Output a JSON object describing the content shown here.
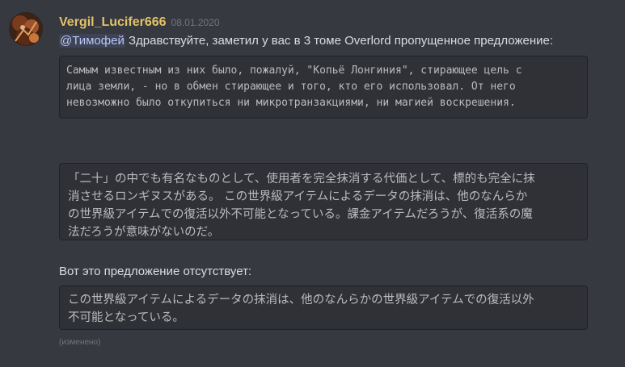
{
  "message": {
    "author": "Vergil_Lucifer666",
    "timestamp": "08.01.2020",
    "mention": "@Тимофей",
    "intro_text": " Здравствуйте, заметил у вас в 3 томе Overlord пропущенное предложение:",
    "code_russian": "Самым известным из них было, пожалуй, \"Копьё Лонгиния\", стирающее цель с\nлица земли, - но в обмен стирающее и того, кто его использовал. От него\nневозможно было откупиться ни микротранзакциями, ни магией воскрешения.",
    "code_japanese": "「二十」の中でも有名なものとして、使用者を完全抹消する代価として、標的も完全に抹\n消させるロンギヌスがある。 この世界級アイテムによるデータの抹消は、他のなんらか\nの世界級アイテムでの復活以外不可能となっている。課金アイテムだろうが、復活系の魔\n法だろうが意味がないのだ。",
    "missing_label": "Вот это предложение отсутствует:",
    "code_missing": "この世界級アイテムによるデータの抹消は、他のなんらかの世界級アイテムでの復活以外\n不可能となっている。",
    "edited_label": "(изменено)"
  },
  "colors": {
    "background": "#36393f",
    "username": "#e3c36a",
    "codeblock_bg": "#2f3136",
    "mention": "#b9c7f7"
  },
  "icons": {
    "avatar": "user-avatar"
  }
}
